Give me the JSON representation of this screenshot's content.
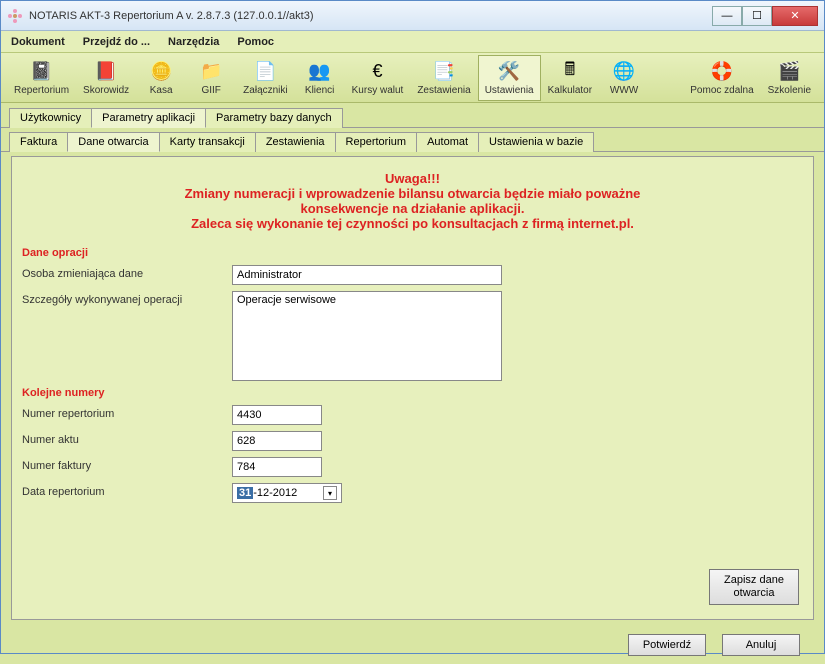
{
  "window": {
    "title": "NOTARIS AKT-3 Repertorium A v. 2.8.7.3 (127.0.0.1//akt3)"
  },
  "menu": {
    "dokument": "Dokument",
    "przejdz": "Przejdź do ...",
    "narzedzia": "Narzędzia",
    "pomoc": "Pomoc"
  },
  "toolbar": {
    "repertorium": "Repertorium",
    "skorowidz": "Skorowidz",
    "kasa": "Kasa",
    "giif": "GIIF",
    "zalaczniki": "Załączniki",
    "klienci": "Klienci",
    "kursy": "Kursy walut",
    "zestawienia": "Zestawienia",
    "ustawienia": "Ustawienia",
    "kalkulator": "Kalkulator",
    "www": "WWW",
    "pomoc_zdalna": "Pomoc zdalna",
    "szkolenie": "Szkolenie"
  },
  "tabs1": {
    "uzytkownicy": "Użytkownicy",
    "parametry_aplikacji": "Parametry aplikacji",
    "parametry_bazy": "Parametry bazy danych"
  },
  "tabs2": {
    "faktura": "Faktura",
    "dane_otwarcia": "Dane otwarcia",
    "karty": "Karty transakcji",
    "zestawienia": "Zestawienia",
    "repertorium": "Repertorium",
    "automat": "Automat",
    "ustawienia_w_bazie": "Ustawienia w bazie"
  },
  "warning": {
    "title": "Uwaga!!!",
    "line1": "Zmiany numeracji i wprowadzenie bilansu otwarcia będzie miało poważne",
    "line2": "konsekwencje na działanie aplikacji.",
    "line3": "Zaleca się wykonanie tej czynności po konsultacjach z firmą internet.pl."
  },
  "sections": {
    "dane_operacji": "Dane opracji",
    "kolejne_numery": "Kolejne numery"
  },
  "labels": {
    "osoba": "Osoba zmieniająca dane",
    "szczegoly": "Szczegóły wykonywanej operacji",
    "numer_repertorium": "Numer repertorium",
    "numer_aktu": "Numer aktu",
    "numer_faktury": "Numer faktury",
    "data_repertorium": "Data repertorium"
  },
  "values": {
    "osoba": "Administrator",
    "szczegoly": "Operacje serwisowe",
    "numer_repertorium": "4430",
    "numer_aktu": "628",
    "numer_faktury": "784",
    "data_day": "31",
    "data_rest": "-12-2012"
  },
  "buttons": {
    "zapisz": "Zapisz dane otwarcia",
    "potwierdz": "Potwierdź",
    "anuluj": "Anuluj"
  }
}
